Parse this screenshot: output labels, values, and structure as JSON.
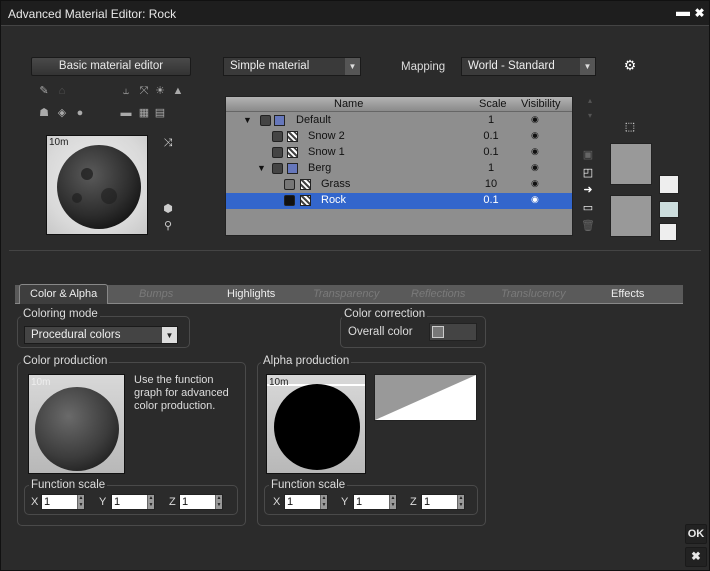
{
  "window": {
    "title": "Advanced Material Editor: Rock",
    "min_icon": "minimize-icon",
    "close_icon": "close-icon"
  },
  "top": {
    "basic_editor_label": "Basic material editor",
    "material_type": "Simple material",
    "mapping_label": "Mapping",
    "mapping_value": "World - Standard",
    "preview_size": "10m"
  },
  "tree": {
    "headers": {
      "name": "Name",
      "scale": "Scale",
      "visibility": "Visibility"
    },
    "rows": [
      {
        "name": "Default",
        "scale": "1"
      },
      {
        "name": "Snow 2",
        "scale": "0.1"
      },
      {
        "name": "Snow 1",
        "scale": "0.1"
      },
      {
        "name": "Berg",
        "scale": "1"
      },
      {
        "name": "Grass",
        "scale": "10"
      },
      {
        "name": "Rock",
        "scale": "0.1"
      }
    ]
  },
  "tabs": [
    "Color & Alpha",
    "Bumps",
    "Highlights",
    "Transparency",
    "Reflections",
    "Translucency",
    "Effects"
  ],
  "coloring_mode": {
    "title": "Coloring mode",
    "value": "Procedural colors"
  },
  "color_correction": {
    "title": "Color correction",
    "overall_label": "Overall color"
  },
  "color_production": {
    "title": "Color production",
    "size": "10m",
    "description": "Use the function graph for advanced color production.",
    "scale_title": "Function scale",
    "x_label": "X",
    "x": "1",
    "y_label": "Y",
    "y": "1",
    "z_label": "Z",
    "z": "1"
  },
  "alpha_production": {
    "title": "Alpha production",
    "size": "10m",
    "scale_title": "Function scale",
    "x_label": "X",
    "x": "1",
    "y_label": "Y",
    "y": "1",
    "z_label": "Z",
    "z": "1"
  },
  "footer": {
    "ok": "OK",
    "cancel": "✖"
  },
  "colors": {
    "selection": "#3366cc",
    "background": "#2b2b2b"
  }
}
